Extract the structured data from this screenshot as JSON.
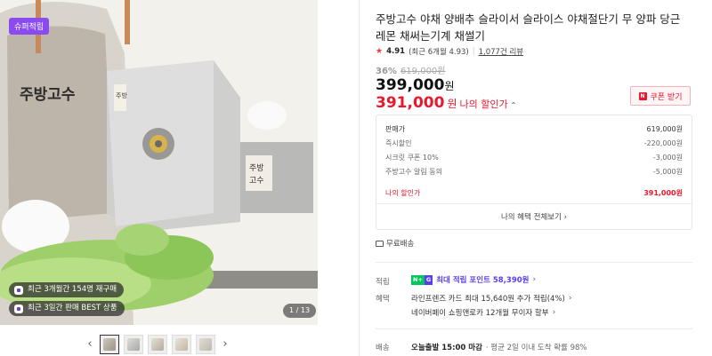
{
  "gallery": {
    "badge": "슈퍼적립",
    "pill1": "최근 3개월간 154명 재구매",
    "pill2": "최근 3일간 판매 BEST 상품",
    "counter": "1 / 13",
    "apron_text": "주방고수",
    "machine_text": "주방고수",
    "prev_arrow": "‹",
    "next_arrow": "›"
  },
  "product": {
    "title": "주방고수 야채 양배추 슬라이서 슬라이스 야채절단기 무 양파 당근 레몬 채써는기계 채썰기",
    "rating": {
      "star": "★",
      "score": "4.91",
      "recent": "(최근 6개월 4.93",
      "recent_close": ")",
      "reviews": "1,077건 리뷰"
    },
    "discount_rate": "36%",
    "original_price": "619,000원",
    "sale_price": "399,000",
    "sale_won": "원",
    "my_price": "391,000",
    "my_won": "원",
    "my_label": "나의 할인가",
    "caret": "⌃",
    "coupon": {
      "icon": "N",
      "label": "쿠폰 받기"
    }
  },
  "breakdown": {
    "rows": [
      {
        "label": "판매가",
        "value": "619,000원"
      },
      {
        "label": "즉시할인",
        "value": "-220,000원"
      },
      {
        "label": "시크릿 쿠폰 10%",
        "value": "-3,000원"
      },
      {
        "label": "주방고수 알림 동의",
        "value": "-5,000원"
      }
    ],
    "mine": {
      "label": "나의 할인가",
      "value": "391,000원"
    },
    "footer": "나의 혜택 전체보기",
    "footer_chev": "›"
  },
  "delivery_free": "무료배송",
  "benefits": {
    "point_label": "적립",
    "npay_a": "N+",
    "npay_b": "G",
    "point_text": "최대 적립 포인트 58,390원",
    "point_chev": "›",
    "benefit_label": "혜택",
    "benefit_1": "라인프렌즈 카드 최대 15,640원 추가 적립(4%)",
    "benefit_1_chev": "›",
    "benefit_2": "네이버페이 쇼핑앤로카 12개월 무이자 할부",
    "benefit_2_chev": "›"
  },
  "shipping": {
    "label": "배송",
    "strong": "오늘출발 15:00 마감",
    "rest": "· 평균 2일 이내 도착 확률 98%"
  },
  "colors": {
    "accent_red": "#e8192c",
    "purple": "#5b3cf0",
    "badge_purple": "#8a4cf0",
    "green": "#03c75a"
  }
}
